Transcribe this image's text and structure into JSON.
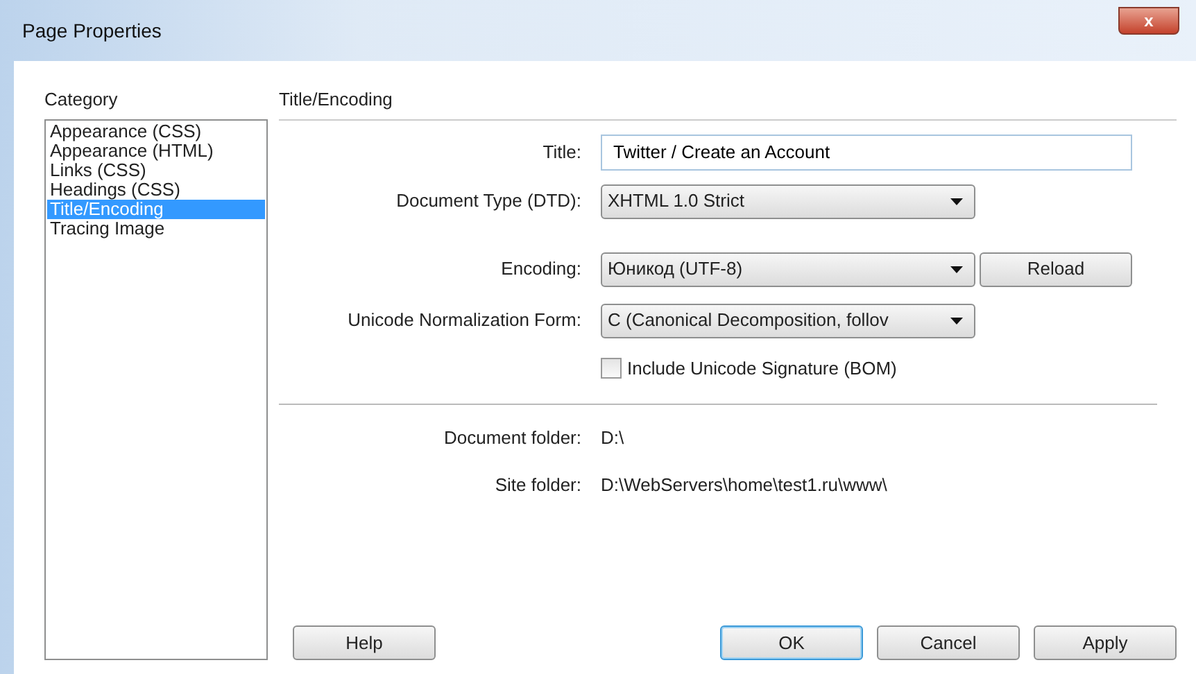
{
  "window": {
    "title": "Page Properties",
    "close_label": "x"
  },
  "category": {
    "label": "Category",
    "items": [
      {
        "label": "Appearance (CSS)",
        "selected": false
      },
      {
        "label": "Appearance (HTML)",
        "selected": false
      },
      {
        "label": "Links (CSS)",
        "selected": false
      },
      {
        "label": "Headings (CSS)",
        "selected": false
      },
      {
        "label": "Title/Encoding",
        "selected": true
      },
      {
        "label": "Tracing Image",
        "selected": false
      }
    ]
  },
  "panel": {
    "heading": "Title/Encoding",
    "title": {
      "label": "Title:",
      "value": "Twitter / Create an Account"
    },
    "document_type": {
      "label": "Document Type (DTD):",
      "value": "XHTML 1.0 Strict"
    },
    "encoding": {
      "label": "Encoding:",
      "value": "Юникод (UTF-8)",
      "button": "Reload"
    },
    "normalization": {
      "label": "Unicode Normalization Form:",
      "value": "C (Canonical Decomposition, follov"
    },
    "signature": {
      "label": "Include Unicode Signature (BOM)",
      "checked": false
    },
    "document_folder": {
      "label": "Document folder:",
      "value": "D:\\"
    },
    "site_folder": {
      "label": "Site folder:",
      "value": "D:\\WebServers\\home\\test1.ru\\www\\"
    }
  },
  "buttons": [
    {
      "label": "Help",
      "default": false
    },
    {
      "label": "OK",
      "default": true
    },
    {
      "label": "Cancel",
      "default": false
    },
    {
      "label": "Apply",
      "default": false
    }
  ]
}
